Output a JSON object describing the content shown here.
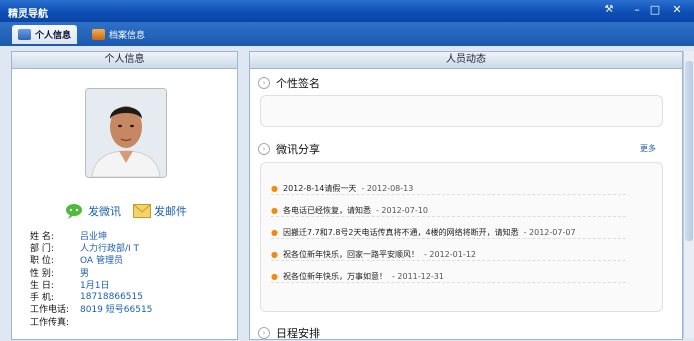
{
  "window": {
    "title": "精灵导航"
  },
  "tabs": [
    {
      "label": "个人信息",
      "active": true
    },
    {
      "label": "档案信息",
      "active": false
    }
  ],
  "left_panel": {
    "header": "个人信息",
    "actions": {
      "weixun": "发微讯",
      "email": "发邮件"
    },
    "fields": [
      {
        "label": "姓    名:",
        "value": "吕业坤"
      },
      {
        "label": "部    门:",
        "value": "人力行政部/I T"
      },
      {
        "label": "职    位:",
        "value": "OA 管理员"
      },
      {
        "label": "性    别:",
        "value": "男"
      },
      {
        "label": "生    日:",
        "value": "1月1日"
      },
      {
        "label": "手    机:",
        "value": "18718866515"
      },
      {
        "label": "工作电话:",
        "value": "8019 短号66515"
      },
      {
        "label": "工作传真:",
        "value": ""
      }
    ]
  },
  "right_panel": {
    "header": "人员动态",
    "signature": {
      "title": "个性签名"
    },
    "weixun": {
      "title": "微讯分享",
      "more": "更多",
      "items": [
        {
          "text": "2012-8-14请假一天",
          "date": " - 2012-08-13"
        },
        {
          "text": "各电话已经恢复，请知悉",
          "date": " - 2012-07-10"
        },
        {
          "text": "因搬迁7.7和7.8号2天电话传真将不通，4楼的网络将断开，请知悉",
          "date": " - 2012-07-07"
        },
        {
          "text": "祝各位新年快乐，回家一路平安顺风！",
          "date": " - 2012-01-12"
        },
        {
          "text": "祝各位新年快乐，万事如意！",
          "date": " - 2011-12-31"
        }
      ]
    },
    "schedule": {
      "title": "日程安排"
    }
  }
}
